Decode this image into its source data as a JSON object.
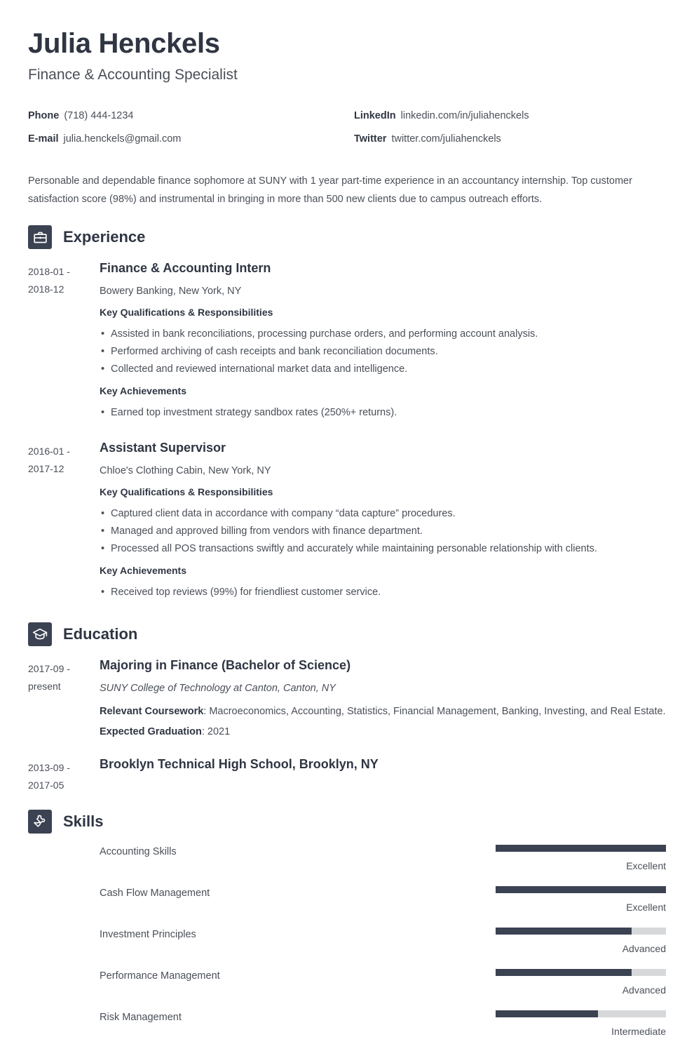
{
  "header": {
    "name": "Julia Henckels",
    "job_title": "Finance & Accounting Specialist",
    "contacts_left": [
      {
        "label": "Phone",
        "value": "(718) 444-1234"
      },
      {
        "label": "E-mail",
        "value": "julia.henckels@gmail.com"
      }
    ],
    "contacts_right": [
      {
        "label": "LinkedIn",
        "value": "linkedin.com/in/juliahenckels"
      },
      {
        "label": "Twitter",
        "value": "twitter.com/juliahenckels"
      }
    ]
  },
  "summary": "Personable and dependable finance sophomore at SUNY with 1 year part-time experience in an accountancy internship. Top customer satisfaction score (98%) and instrumental in bringing in more than 500 new clients due to campus outreach efforts.",
  "sections": {
    "experience": {
      "title": "Experience",
      "icon": "briefcase-icon",
      "entries": [
        {
          "date_start": "2018-01 -",
          "date_end": "2018-12",
          "role": "Finance & Accounting Intern",
          "org": "Bowery Banking, New York, NY",
          "qualifications_heading": "Key Qualifications & Responsibilities",
          "qualifications": [
            "Assisted in bank reconciliations, processing purchase orders, and performing account analysis.",
            "Performed archiving of cash receipts and bank reconciliation documents.",
            "Collected and reviewed international market data and intelligence."
          ],
          "achievements_heading": "Key Achievements",
          "achievements": [
            "Earned top investment strategy sandbox rates (250%+ returns)."
          ]
        },
        {
          "date_start": "2016-01 -",
          "date_end": "2017-12",
          "role": "Assistant Supervisor",
          "org": "Chloe's Clothing Cabin, New York, NY",
          "qualifications_heading": "Key Qualifications & Responsibilities",
          "qualifications": [
            "Captured client data in accordance with company “data capture” procedures.",
            "Managed and approved billing from vendors with finance department.",
            "Processed all POS transactions swiftly and accurately while maintaining personable relationship with clients."
          ],
          "achievements_heading": "Key Achievements",
          "achievements": [
            "Received top reviews (99%) for friendliest customer service."
          ]
        }
      ]
    },
    "education": {
      "title": "Education",
      "icon": "graduation-cap-icon",
      "entries": [
        {
          "date_start": "2017-09 -",
          "date_end": "present",
          "degree": "Majoring in Finance (Bachelor of Science)",
          "school": "SUNY College of Technology at Canton, Canton, NY",
          "coursework_label": "Relevant Coursework",
          "coursework_value": ": Macroeconomics, Accounting, Statistics, Financial Management, Banking, Investing, and Real Estate.",
          "graduation_label": "Expected Graduation",
          "graduation_value": ": 2021"
        },
        {
          "date_start": "2013-09 -",
          "date_end": "2017-05",
          "degree": "Brooklyn Technical High School, Brooklyn, NY",
          "school": "",
          "coursework_label": "",
          "coursework_value": "",
          "graduation_label": "",
          "graduation_value": ""
        }
      ]
    },
    "skills": {
      "title": "Skills",
      "icon": "puzzle-piece-icon",
      "items": [
        {
          "name": "Accounting Skills",
          "level": "Excellent",
          "percent": 100
        },
        {
          "name": "Cash Flow Management",
          "level": "Excellent",
          "percent": 100
        },
        {
          "name": "Investment Principles",
          "level": "Advanced",
          "percent": 80
        },
        {
          "name": "Performance Management",
          "level": "Advanced",
          "percent": 80
        },
        {
          "name": "Risk Management",
          "level": "Intermediate",
          "percent": 60
        }
      ]
    }
  },
  "colors": {
    "ink": "#2f3542",
    "body": "#4a4f57",
    "accent": "#3b4252",
    "track": "#d6d8da"
  }
}
